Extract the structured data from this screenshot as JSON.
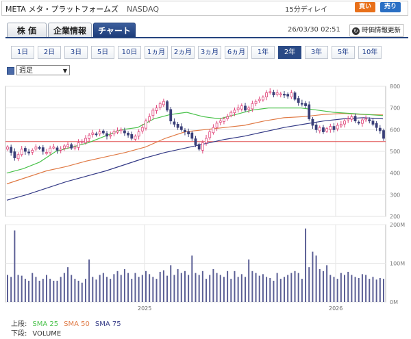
{
  "header": {
    "symbol": "META",
    "name": "メタ・プラットフォームズ",
    "market": "NASDAQ",
    "delay": "15分ディレイ",
    "buy_label": "買い",
    "sell_label": "売り"
  },
  "tabs": [
    "株 価",
    "企業情報",
    "チャート"
  ],
  "timestamp": "26/03/30 02:51",
  "refresh_label": "時価情報更新",
  "periods": [
    "1日",
    "2日",
    "3日",
    "5日",
    "10日",
    "1ヵ月",
    "2ヵ月",
    "3ヵ月",
    "6ヵ月",
    "1年",
    "2年",
    "3年",
    "5年",
    "10年"
  ],
  "selected_period": "2年",
  "interval_select": "週足",
  "legend": {
    "upper_prefix": "上段:",
    "sma25": "SMA 25",
    "sma50": "SMA 50",
    "sma75": "SMA 75",
    "lower_prefix": "下段:",
    "volume": "VOLUME"
  },
  "colors": {
    "up": "#e0457a",
    "down": "#3a3f78",
    "sma25": "#49c24a",
    "sma50": "#e07a45",
    "sma75": "#343a86",
    "volume": "#5b5f95",
    "refline": "#e05050"
  },
  "chart_data": [
    {
      "type": "candlestick",
      "x_labels": [
        "2025",
        "2026"
      ],
      "yticks": [
        200,
        300,
        400,
        500,
        600,
        700,
        800
      ],
      "ylim": [
        200,
        800
      ],
      "reference_line": 545,
      "weekly_close": [
        520,
        495,
        470,
        485,
        510,
        500,
        495,
        505,
        520,
        515,
        500,
        495,
        515,
        520,
        505,
        510,
        525,
        530,
        515,
        520,
        540,
        545,
        560,
        575,
        585,
        580,
        590,
        585,
        570,
        575,
        590,
        595,
        600,
        585,
        575,
        560,
        570,
        590,
        610,
        640,
        660,
        690,
        700,
        720,
        730,
        690,
        640,
        625,
        610,
        600,
        590,
        580,
        560,
        530,
        510,
        540,
        560,
        590,
        610,
        630,
        640,
        650,
        660,
        680,
        690,
        700,
        710,
        690,
        700,
        720,
        730,
        740,
        750,
        770,
        775,
        760,
        770,
        765,
        760,
        755,
        770,
        740,
        725,
        720,
        710,
        650,
        620,
        600,
        610,
        590,
        605,
        615,
        600,
        620,
        625,
        640,
        650,
        660,
        640,
        630,
        645,
        650,
        640,
        625,
        610,
        595,
        560
      ],
      "sma25": [
        400,
        420,
        450,
        500,
        520,
        540,
        570,
        600,
        610,
        650,
        670,
        680,
        660,
        650,
        670,
        690,
        700,
        700,
        700,
        690,
        680,
        675,
        670,
        665
      ],
      "sma50": [
        350,
        380,
        410,
        430,
        455,
        475,
        495,
        520,
        560,
        590,
        600,
        610,
        620,
        640,
        655,
        660,
        670,
        675,
        670,
        668
      ],
      "sma75": [
        275,
        300,
        330,
        360,
        385,
        410,
        440,
        470,
        495,
        515,
        535,
        555,
        570,
        590,
        610,
        625,
        640,
        650,
        655,
        650
      ]
    },
    {
      "type": "bar",
      "title": "VOLUME",
      "yticks": [
        "0M",
        "100M",
        "200M"
      ],
      "ylim": [
        0,
        200
      ],
      "values": [
        70,
        65,
        185,
        70,
        68,
        60,
        55,
        75,
        65,
        55,
        60,
        70,
        60,
        55,
        55,
        65,
        75,
        90,
        70,
        60,
        55,
        50,
        60,
        110,
        65,
        58,
        70,
        75,
        65,
        60,
        72,
        80,
        70,
        85,
        75,
        60,
        75,
        65,
        70,
        80,
        72,
        65,
        60,
        78,
        82,
        68,
        95,
        70,
        85,
        75,
        80,
        70,
        120,
        75,
        70,
        80,
        60,
        70,
        85,
        75,
        70,
        65,
        80,
        60,
        80,
        65,
        72,
        65,
        110,
        80,
        75,
        68,
        72,
        65,
        62,
        55,
        75,
        60,
        65,
        70,
        75,
        80,
        75,
        60,
        190,
        90,
        130,
        120,
        85,
        80,
        95,
        70,
        65,
        60,
        75,
        70,
        78,
        70,
        65,
        62,
        72,
        70,
        60,
        65,
        58,
        62,
        60
      ]
    }
  ]
}
